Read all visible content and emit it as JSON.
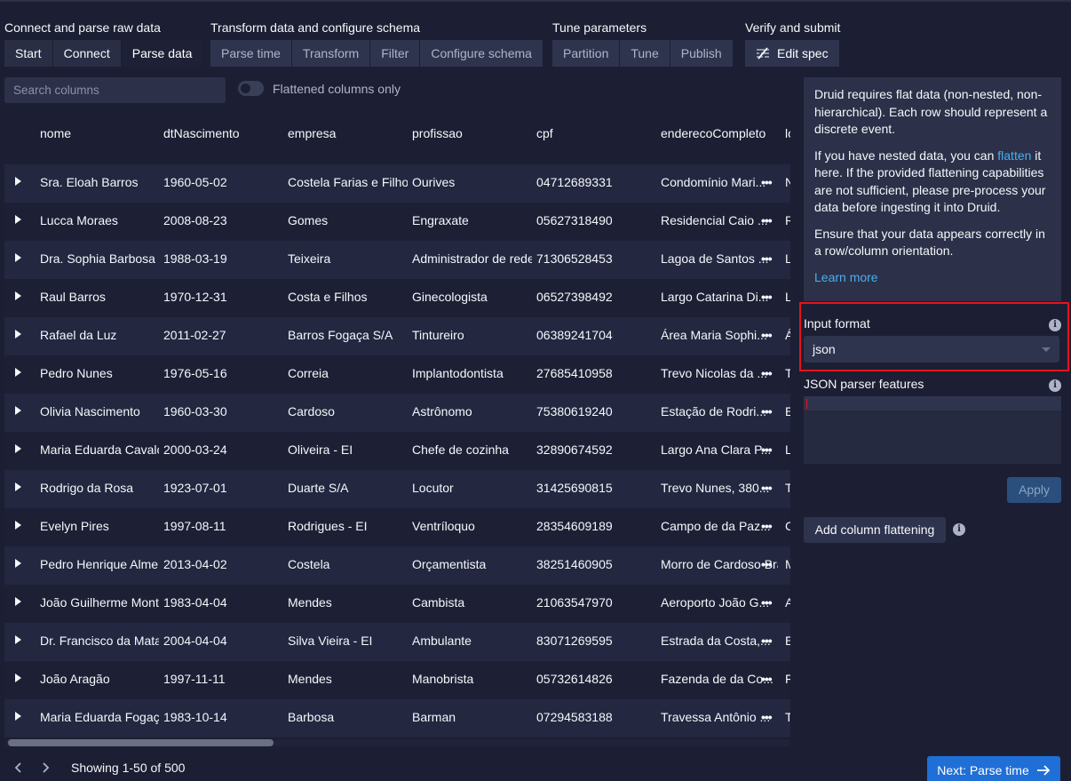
{
  "steps": {
    "group1": {
      "title": "Connect and parse raw data",
      "buttons": [
        "Start",
        "Connect",
        "Parse data"
      ]
    },
    "group2": {
      "title": "Transform data and configure schema",
      "buttons": [
        "Parse time",
        "Transform",
        "Filter",
        "Configure schema"
      ]
    },
    "group3": {
      "title": "Tune parameters",
      "buttons": [
        "Partition",
        "Tune",
        "Publish"
      ]
    },
    "group4": {
      "title": "Verify and submit",
      "edit_label": "Edit spec"
    }
  },
  "search": {
    "placeholder": "Search columns"
  },
  "toggle": {
    "label": "Flattened columns only"
  },
  "table": {
    "columns": [
      "nome",
      "dtNascimento",
      "empresa",
      "profissao",
      "cpf",
      "enderecoCompleto",
      "lo"
    ],
    "rows": [
      [
        "Sra. Eloah Barros",
        "1960-05-02",
        "Costela Farias e Filhos",
        "Ourives",
        "04712689331",
        "Condomínio Mari...",
        "N"
      ],
      [
        "Lucca Moraes",
        "2008-08-23",
        "Gomes",
        "Engraxate",
        "05627318490",
        "Residencial Caio ...",
        "R"
      ],
      [
        "Dra. Sophia Barbosa",
        "1988-03-19",
        "Teixeira",
        "Administrador de rede",
        "71306528453",
        "Lagoa de Santos ...",
        "L"
      ],
      [
        "Raul Barros",
        "1970-12-31",
        "Costa e Filhos",
        "Ginecologista",
        "06527398492",
        "Largo Catarina Di...",
        "L"
      ],
      [
        "Rafael da Luz",
        "2011-02-27",
        "Barros Fogaça S/A",
        "Tintureiro",
        "06389241704",
        "Área Maria Sophi...",
        "Á"
      ],
      [
        "Pedro Nunes",
        "1976-05-16",
        "Correia",
        "Implantodontista",
        "27685410958",
        "Trevo Nicolas da ...",
        "T"
      ],
      [
        "Olivia Nascimento",
        "1960-03-30",
        "Cardoso",
        "Astrônomo",
        "75380619240",
        "Estação de Rodri...",
        "E"
      ],
      [
        "Maria Eduarda Cavalcante",
        "2000-03-24",
        "Oliveira - EI",
        "Chefe de cozinha",
        "32890674592",
        "Largo Ana Clara P...",
        "L"
      ],
      [
        "Rodrigo da Rosa",
        "1923-07-01",
        "Duarte S/A",
        "Locutor",
        "31425690815",
        "Trevo Nunes, 380...",
        "T"
      ],
      [
        "Evelyn Pires",
        "1997-08-11",
        "Rodrigues - EI",
        "Ventríloquo",
        "28354609189",
        "Campo de da Paz...",
        "C"
      ],
      [
        "Pedro Henrique Almeida",
        "2013-04-02",
        "Costela",
        "Orçamentista",
        "38251460905",
        "Morro de Cardoso Bra",
        "M"
      ],
      [
        "João Guilherme Monteiro",
        "1983-04-04",
        "Mendes",
        "Cambista",
        "21063547970",
        "Aeroporto João G...",
        "A"
      ],
      [
        "Dr. Francisco da Mata",
        "2004-04-04",
        "Silva Vieira - EI",
        "Ambulante",
        "83071269595",
        "Estrada da Costa,...",
        "E"
      ],
      [
        "João Aragão",
        "1997-11-11",
        "Mendes",
        "Manobrista",
        "05732614826",
        "Fazenda de da Co...",
        "F"
      ],
      [
        "Maria Eduarda Fogaça",
        "1983-10-14",
        "Barbosa",
        "Barman",
        "07294583188",
        "Travessa Antônio ...",
        "T"
      ]
    ]
  },
  "pager": {
    "showing": "Showing 1-50 of 500"
  },
  "next_button": {
    "label": "Next: Parse time"
  },
  "info": {
    "p1": "Druid requires flat data (non-nested, non-hierarchical). Each row should represent a discrete event.",
    "p2_before": "If you have nested data, you can ",
    "p2_link": "flatten",
    "p2_after": " it here. If the provided flattening capabilities are not sufficient, please pre-process your data before ingesting it into Druid.",
    "p3": "Ensure that your data appears correctly in a row/column orientation.",
    "learn_more": "Learn more"
  },
  "input_format": {
    "label": "Input format",
    "value": "json"
  },
  "json_parser": {
    "label": "JSON parser features"
  },
  "apply_label": "Apply",
  "add_flattening_label": "Add column flattening",
  "colors": {
    "accent": "#1f6fd6",
    "highlight": "#e8121b",
    "link": "#48aff0"
  }
}
